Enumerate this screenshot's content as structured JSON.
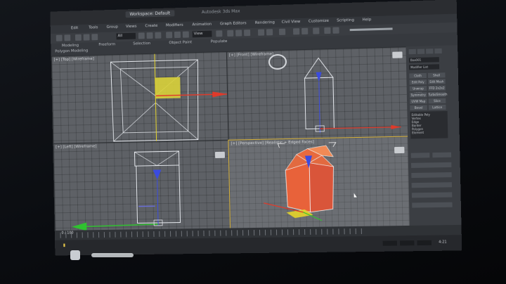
{
  "window": {
    "tab_label": "Workspace: Default",
    "app_title": "Autodesk 3ds Max",
    "project_name": "",
    "path": ""
  },
  "menu": {
    "items": [
      "Edit",
      "Tools",
      "Group",
      "Views",
      "Create",
      "Modifiers",
      "Animation",
      "Graph Editors",
      "Rendering",
      "Civil View",
      "Customize",
      "Scripting",
      "Help"
    ]
  },
  "toolbar": {
    "selection_filter": "All",
    "view_dropdown": "View"
  },
  "ribbon": {
    "tabs": [
      "Modeling",
      "Freeform",
      "Selection",
      "Object Paint",
      "Populate"
    ],
    "active_tab": "Modeling",
    "sub_label": "Polygon Modeling"
  },
  "viewports": {
    "top": "[+] [Top] [Wireframe]",
    "front": "[+] [Front] [Wireframe]",
    "left": "[+] [Left] [Wireframe]",
    "perspective": "[+] [Perspective] [Realistic + Edged Faces]"
  },
  "command_panel": {
    "object_name": "Box001",
    "modifier_list": "Modifier List",
    "buttons": [
      "Cloth",
      "Shell",
      "Edit Poly",
      "Edit Mesh",
      "Unwrap UVW",
      "FFD 2x2x2",
      "Symmetry",
      "TurboSmooth",
      "UVW Map",
      "Slice",
      "Bevel",
      "Lattice"
    ],
    "stack": [
      "Editable Poly",
      "Vertex",
      "Edge",
      "Border",
      "Polygon",
      "Element"
    ]
  },
  "timeline": {
    "frame_readout": "0 / 100"
  },
  "status": {
    "selection_text": "",
    "coords": [
      "X:",
      "Y:",
      "Z:"
    ],
    "time": "4:21"
  },
  "colors": {
    "object_orange": "#e8623a",
    "axis_red": "#e03a2a",
    "axis_green": "#2fc22f",
    "axis_blue": "#3a4be0",
    "gizmo_yellow": "#e6d52a",
    "wire_white": "#e4e6ea"
  }
}
